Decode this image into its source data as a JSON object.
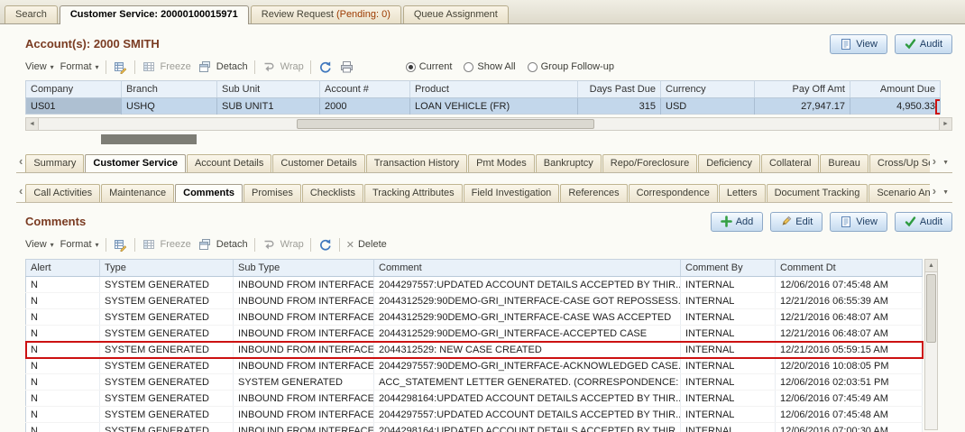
{
  "theme": {
    "title_color": "#7a3b22",
    "highlight_red": "#cc1111",
    "selected_row": "#c3d7eb",
    "grid_header_bg": "#e9f1f9"
  },
  "icons": {
    "caret_down": "▾",
    "overflow_down": "▼",
    "scroll_left": "‹",
    "scroll_right": "›",
    "arrow_left": "◄",
    "arrow_right": "►",
    "arrow_up": "▲",
    "delete_x": "✕"
  },
  "top_tabs": [
    {
      "label": "Search",
      "active": false
    },
    {
      "label": "Customer Service: 20000100015971",
      "active": true
    },
    {
      "label": "Review Request ",
      "suffix": "(Pending: 0)",
      "active": false
    },
    {
      "label": "Queue Assignment",
      "active": false
    }
  ],
  "account": {
    "title": "Account(s): 2000 SMITH",
    "buttons": {
      "view": "View",
      "audit": "Audit"
    },
    "toolbar": {
      "view": "View",
      "format": "Format",
      "freeze": "Freeze",
      "detach": "Detach",
      "wrap": "Wrap",
      "radios": [
        {
          "label": "Current",
          "selected": true
        },
        {
          "label": "Show All",
          "selected": false
        },
        {
          "label": "Group Follow-up",
          "selected": false
        }
      ]
    },
    "table": {
      "columns": [
        "Company",
        "Branch",
        "Sub Unit",
        "Account #",
        "Product",
        "Days Past Due",
        "Currency",
        "Pay Off Amt",
        "Amount Due"
      ],
      "rows": [
        {
          "company": "US01",
          "branch": "USHQ",
          "sub_unit": "SUB UNIT1",
          "account": "2000",
          "product": "LOAN VEHICLE (FR)",
          "days_past_due": "315",
          "currency": "USD",
          "pay_off_amt": "27,947.17",
          "amount_due": "4,950.33"
        }
      ]
    }
  },
  "level1_tabs": [
    {
      "label": "Summary"
    },
    {
      "label": "Customer Service",
      "active": true
    },
    {
      "label": "Account Details"
    },
    {
      "label": "Customer Details"
    },
    {
      "label": "Transaction History"
    },
    {
      "label": "Pmt Modes"
    },
    {
      "label": "Bankruptcy"
    },
    {
      "label": "Repo/Foreclosure"
    },
    {
      "label": "Deficiency"
    },
    {
      "label": "Collateral"
    },
    {
      "label": "Bureau"
    },
    {
      "label": "Cross/Up Sell Ac"
    }
  ],
  "level2_tabs": [
    {
      "label": "Call Activities"
    },
    {
      "label": "Maintenance"
    },
    {
      "label": "Comments",
      "active": true
    },
    {
      "label": "Promises"
    },
    {
      "label": "Checklists"
    },
    {
      "label": "Tracking Attributes"
    },
    {
      "label": "Field Investigation"
    },
    {
      "label": "References"
    },
    {
      "label": "Correspondence"
    },
    {
      "label": "Letters"
    },
    {
      "label": "Document Tracking"
    },
    {
      "label": "Scenario An"
    }
  ],
  "comments": {
    "title": "Comments",
    "buttons": {
      "add": "Add",
      "edit": "Edit",
      "view": "View",
      "audit": "Audit"
    },
    "toolbar": {
      "view": "View",
      "format": "Format",
      "freeze": "Freeze",
      "detach": "Detach",
      "wrap": "Wrap",
      "delete": "Delete"
    },
    "table": {
      "columns": [
        "Alert",
        "Type",
        "Sub Type",
        "Comment",
        "Comment By",
        "Comment Dt"
      ],
      "highlighted_row_index": 4,
      "rows": [
        [
          "N",
          "SYSTEM GENERATED",
          "INBOUND FROM INTERFACE",
          "2044297557:UPDATED ACCOUNT DETAILS ACCEPTED BY THIR...",
          "INTERNAL",
          "12/06/2016 07:45:48 AM"
        ],
        [
          "N",
          "SYSTEM GENERATED",
          "INBOUND FROM INTERFACE",
          "2044312529:90DEMO-GRI_INTERFACE-CASE GOT REPOSSESS...",
          "INTERNAL",
          "12/21/2016 06:55:39 AM"
        ],
        [
          "N",
          "SYSTEM GENERATED",
          "INBOUND FROM INTERFACE",
          "2044312529:90DEMO-GRI_INTERFACE-CASE WAS ACCEPTED",
          "INTERNAL",
          "12/21/2016 06:48:07 AM"
        ],
        [
          "N",
          "SYSTEM GENERATED",
          "INBOUND FROM INTERFACE",
          "2044312529:90DEMO-GRI_INTERFACE-ACCEPTED CASE",
          "INTERNAL",
          "12/21/2016 06:48:07 AM"
        ],
        [
          "N",
          "SYSTEM GENERATED",
          "INBOUND FROM INTERFACE",
          "2044312529: NEW CASE CREATED",
          "INTERNAL",
          "12/21/2016 05:59:15 AM"
        ],
        [
          "N",
          "SYSTEM GENERATED",
          "INBOUND FROM INTERFACE",
          "2044297557:90DEMO-GRI_INTERFACE-ACKNOWLEDGED CASE...",
          "INTERNAL",
          "12/20/2016 10:08:05 PM"
        ],
        [
          "N",
          "SYSTEM GENERATED",
          "SYSTEM GENERATED",
          "ACC_STATEMENT LETTER GENERATED. (CORRESPONDENCE: C...",
          "INTERNAL",
          "12/06/2016 02:03:51 PM"
        ],
        [
          "N",
          "SYSTEM GENERATED",
          "INBOUND FROM INTERFACE",
          "2044298164:UPDATED ACCOUNT DETAILS ACCEPTED BY THIR...",
          "INTERNAL",
          "12/06/2016 07:45:49 AM"
        ],
        [
          "N",
          "SYSTEM GENERATED",
          "INBOUND FROM INTERFACE",
          "2044297557:UPDATED ACCOUNT DETAILS ACCEPTED BY THIR...",
          "INTERNAL",
          "12/06/2016 07:45:48 AM"
        ],
        [
          "N",
          "SYSTEM GENERATED",
          "INBOUND FROM INTERFACE",
          "2044298164:UPDATED ACCOUNT DETAILS ACCEPTED BY THIR...",
          "INTERNAL",
          "12/06/2016 07:00:30 AM"
        ]
      ]
    }
  }
}
